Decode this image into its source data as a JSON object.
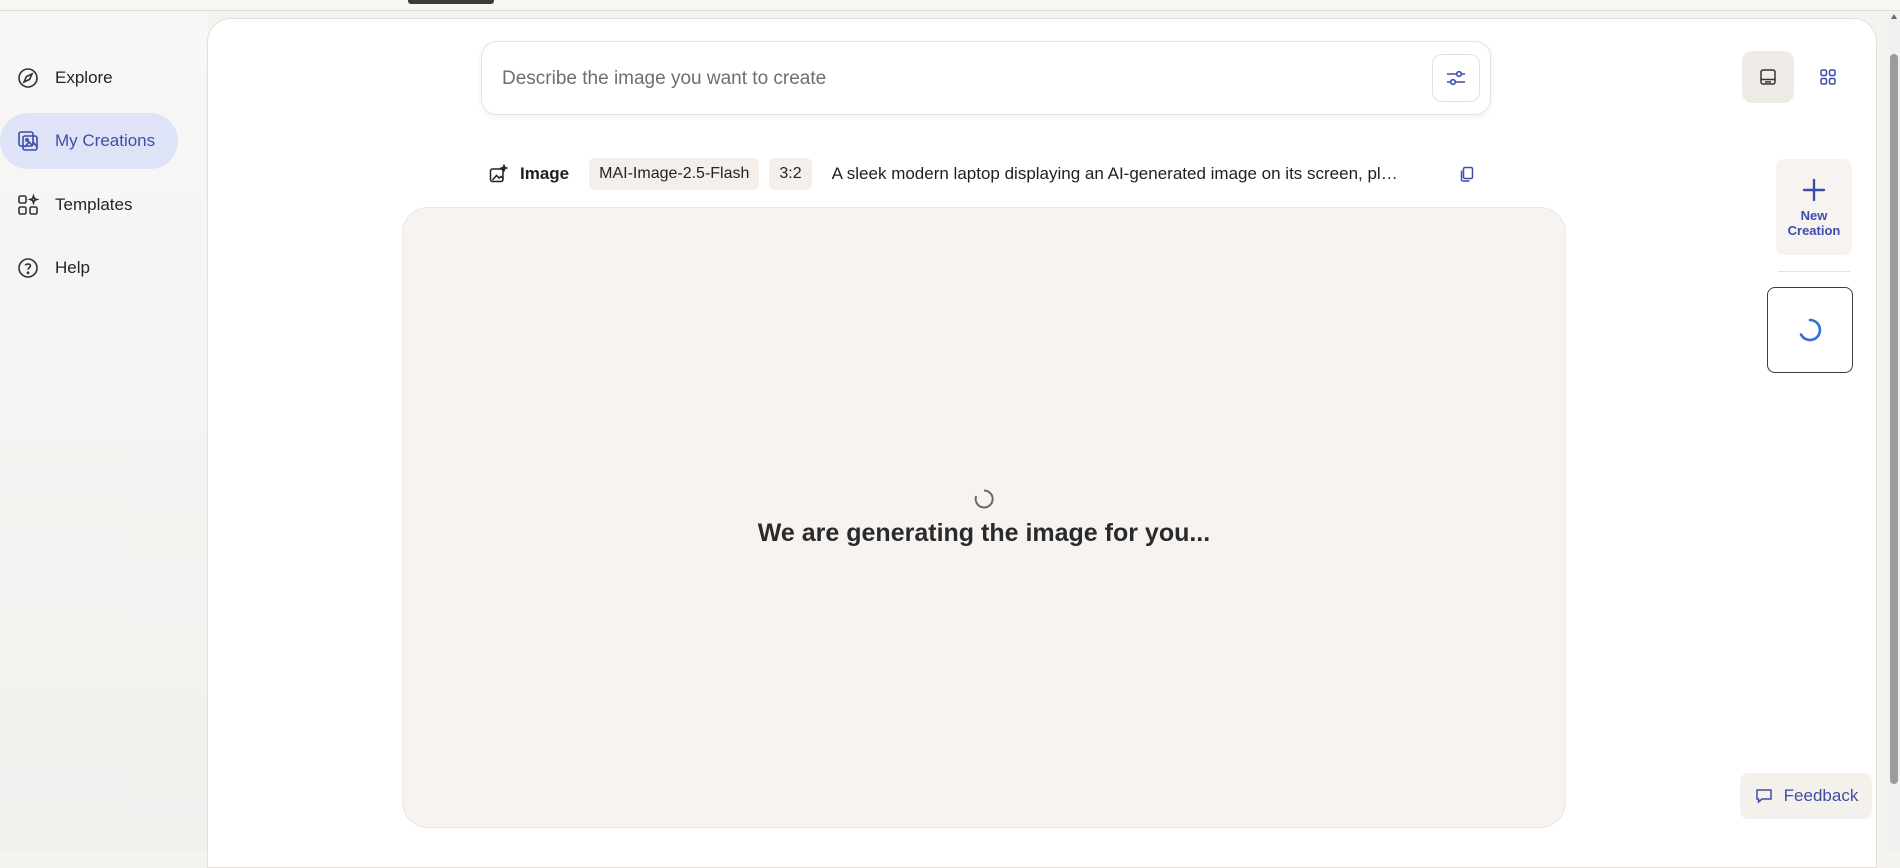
{
  "sidebar": {
    "items": [
      {
        "label": "Explore",
        "icon": "compass-icon",
        "active": false
      },
      {
        "label": "My Creations",
        "icon": "image-gallery-icon",
        "active": true
      },
      {
        "label": "Templates",
        "icon": "templates-icon",
        "active": false
      },
      {
        "label": "Help",
        "icon": "help-icon",
        "active": false
      }
    ]
  },
  "prompt": {
    "placeholder": "Describe the image you want to create",
    "value": ""
  },
  "meta": {
    "type_label": "Image",
    "model": "MAI-Image-2.5-Flash",
    "aspect": "3:2",
    "prompt_text": "A sleek modern laptop displaying an AI-generated image on its screen, pl…"
  },
  "status": {
    "message": "We are generating the image for you..."
  },
  "actions": {
    "new_creation_line1": "New",
    "new_creation_line2": "Creation",
    "feedback_label": "Feedback"
  },
  "colors": {
    "accent": "#3d4da8",
    "active_nav_bg": "#dfe3f8",
    "canvas_bg": "#f7f3f0"
  }
}
